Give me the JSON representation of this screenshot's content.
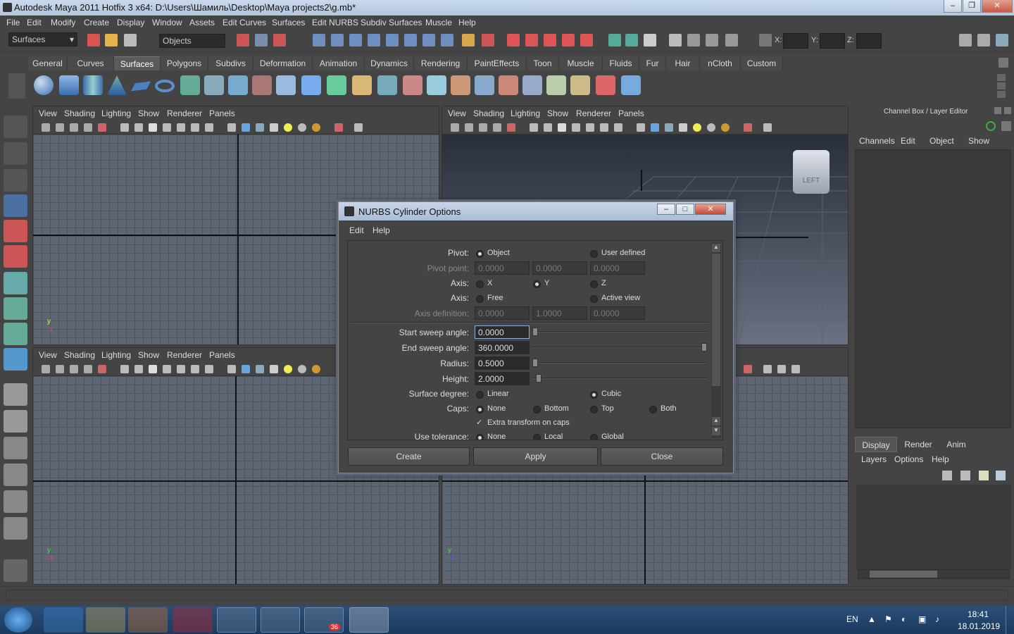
{
  "window": {
    "title": "Autodesk Maya 2011 Hotfix 3 x64: D:\\Users\\Шамиль\\Desktop\\Maya projects2\\g.mb*"
  },
  "menubar": [
    "File",
    "Edit",
    "Modify",
    "Create",
    "Display",
    "Window",
    "Assets",
    "Edit Curves",
    "Surfaces",
    "Edit NURBS",
    "Subdiv Surfaces",
    "Muscle",
    "Help"
  ],
  "statusline": {
    "mode": "Surfaces",
    "selection": "Objects",
    "x_label": "X:",
    "y_label": "Y:",
    "z_label": "Z:"
  },
  "shelf_tabs": [
    "General",
    "Curves",
    "Surfaces",
    "Polygons",
    "Subdivs",
    "Deformation",
    "Animation",
    "Dynamics",
    "Rendering",
    "PaintEffects",
    "Toon",
    "Muscle",
    "Fluids",
    "Fur",
    "Hair",
    "nCloth",
    "Custom"
  ],
  "shelf_active": "Surfaces",
  "viewport_menu": [
    "View",
    "Shading",
    "Lighting",
    "Show",
    "Renderer",
    "Panels"
  ],
  "viewcube_label": "LEFT",
  "channel_box": {
    "title": "Channel Box / Layer Editor",
    "menu": [
      "Channels",
      "Edit",
      "Object",
      "Show"
    ],
    "tabs": [
      "Display",
      "Render",
      "Anim"
    ],
    "layer_menu": [
      "Layers",
      "Options",
      "Help"
    ]
  },
  "dialog": {
    "title": "NURBS Cylinder Options",
    "menu": [
      "Edit",
      "Help"
    ],
    "pivot": {
      "label": "Pivot:",
      "options": [
        "Object",
        "User defined"
      ],
      "selected": "Object"
    },
    "pivot_point": {
      "label": "Pivot point:",
      "values": [
        "0.0000",
        "0.0000",
        "0.0000"
      ]
    },
    "axis": {
      "label": "Axis:",
      "options": [
        "X",
        "Y",
        "Z"
      ],
      "selected": "Y"
    },
    "axis2": {
      "label": "Axis:",
      "options": [
        "Free",
        "Active view"
      ]
    },
    "axis_definition": {
      "label": "Axis definition:",
      "values": [
        "0.0000",
        "1.0000",
        "0.0000"
      ]
    },
    "start_sweep": {
      "label": "Start sweep angle:",
      "value": "0.0000",
      "level": 0.0
    },
    "end_sweep": {
      "label": "End sweep angle:",
      "value": "360.0000",
      "level": 1.0
    },
    "radius": {
      "label": "Radius:",
      "value": "0.5000",
      "level": 0.0
    },
    "height": {
      "label": "Height:",
      "value": "2.0000",
      "level": 0.02
    },
    "surface_degree": {
      "label": "Surface degree:",
      "options": [
        "Linear",
        "Cubic"
      ],
      "selected": "Cubic"
    },
    "caps": {
      "label": "Caps:",
      "options": [
        "None",
        "Bottom",
        "Top",
        "Both"
      ],
      "selected": "None"
    },
    "extra_transform": {
      "label": "Extra transform on caps",
      "checked": true
    },
    "use_tolerance": {
      "label": "Use tolerance:",
      "options": [
        "None",
        "Local",
        "Global"
      ],
      "selected": "None"
    },
    "buttons": {
      "create": "Create",
      "apply": "Apply",
      "close": "Close"
    }
  },
  "taskbar": {
    "lang": "EN",
    "time": "18:41",
    "date": "18.01.2019",
    "telegram_badge": "36"
  }
}
